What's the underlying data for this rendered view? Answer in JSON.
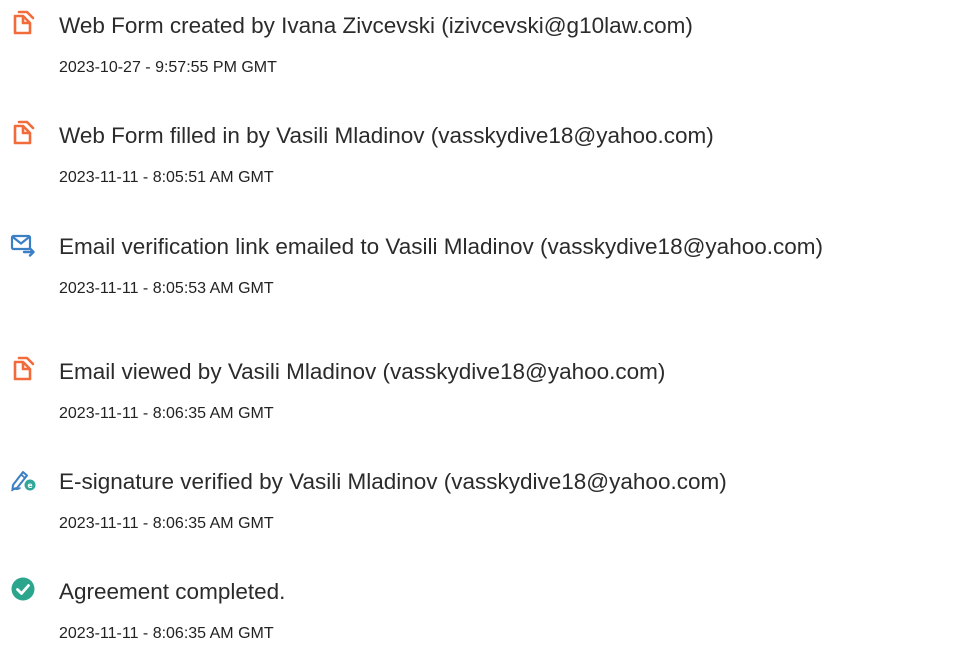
{
  "colors": {
    "icon_orange": "#f26b3a",
    "icon_blue": "#3b7fc4",
    "icon_teal": "#2fa89a",
    "check_green": "#2ca58d"
  },
  "events": [
    {
      "icon": "document-icon",
      "description": "Web Form created by Ivana Zivcevski (izivcevski@g10law.com)",
      "timestamp": "2023-10-27 - 9:57:55 PM GMT"
    },
    {
      "icon": "document-icon",
      "description": "Web Form filled in by Vasili Mladinov (vasskydive18@yahoo.com)",
      "timestamp": "2023-11-11 - 8:05:51 AM GMT"
    },
    {
      "icon": "email-send-icon",
      "description": "Email verification link emailed to Vasili Mladinov (vasskydive18@yahoo.com)",
      "timestamp": "2023-11-11 - 8:05:53 AM GMT"
    },
    {
      "icon": "document-icon",
      "description": "Email viewed by Vasili Mladinov (vasskydive18@yahoo.com)",
      "timestamp": "2023-11-11 - 8:06:35 AM GMT"
    },
    {
      "icon": "esignature-icon",
      "description": "E-signature verified by Vasili Mladinov (vasskydive18@yahoo.com)",
      "timestamp": "2023-11-11 - 8:06:35 AM GMT"
    },
    {
      "icon": "checkmark-circle-icon",
      "description": "Agreement completed.",
      "timestamp": "2023-11-11 - 8:06:35 AM GMT"
    }
  ]
}
